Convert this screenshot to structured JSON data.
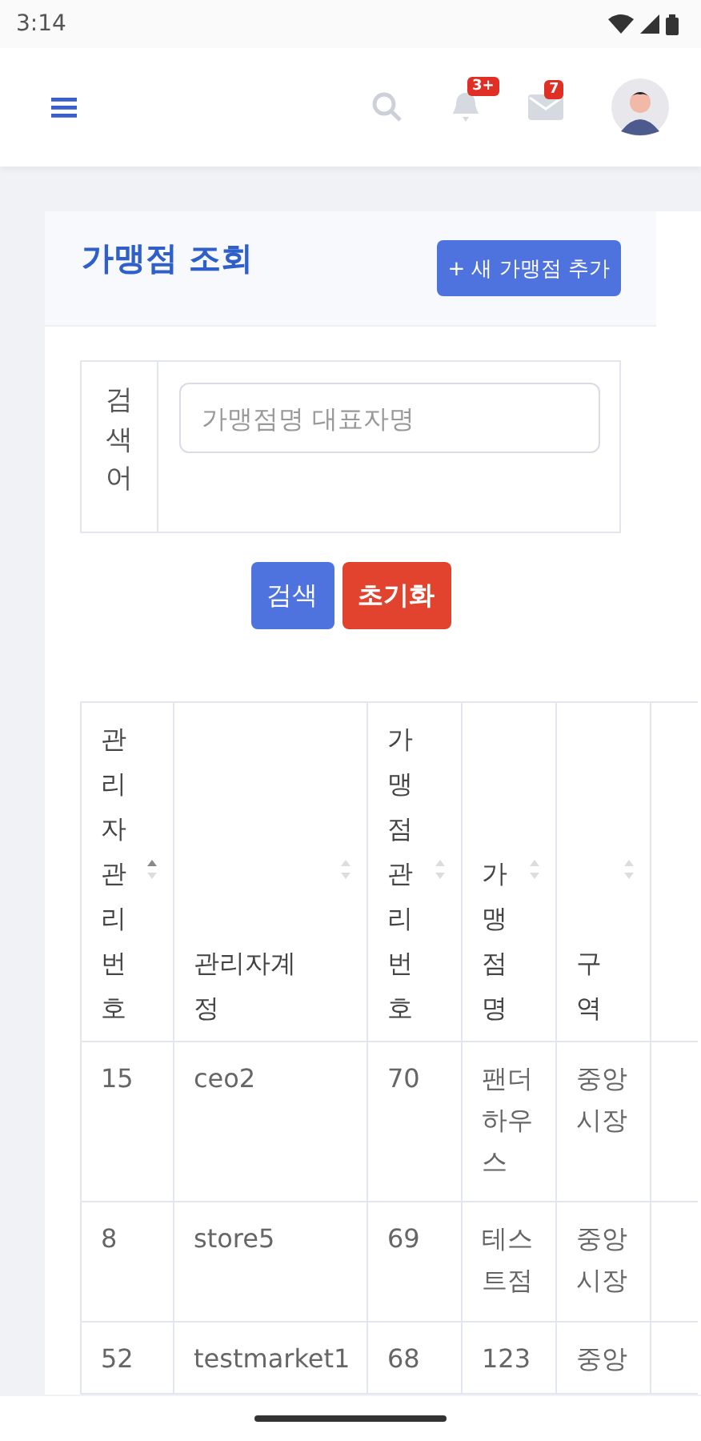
{
  "status_bar": {
    "time": "3:14"
  },
  "app_bar": {
    "notifications_badge": "3+",
    "messages_badge": "7"
  },
  "card": {
    "title": "가맹점 조회",
    "add_button": "+ 새 가맹점 추가",
    "search": {
      "label": "검색어",
      "placeholder": "가맹점명 대표자명"
    },
    "buttons": [
      {
        "label": "검색",
        "kind": "primary"
      },
      {
        "label": "초기화",
        "kind": "danger"
      }
    ]
  },
  "table": {
    "columns": [
      {
        "label": "관리자관리번호",
        "sorted": true
      },
      {
        "label": "관리자계정",
        "sorted": false
      },
      {
        "label": "가맹점관리번호",
        "sorted": false
      },
      {
        "label": "가맹점명",
        "sorted": false
      },
      {
        "label": "구역",
        "sorted": false
      }
    ],
    "rows": [
      [
        "15",
        "ceo2",
        "70",
        "팬더하우스",
        "중앙시장"
      ],
      [
        "8",
        "store5",
        "69",
        "테스트점",
        "중앙시장"
      ],
      [
        "52",
        "testmarket1",
        "68",
        "123",
        "중앙"
      ]
    ]
  }
}
